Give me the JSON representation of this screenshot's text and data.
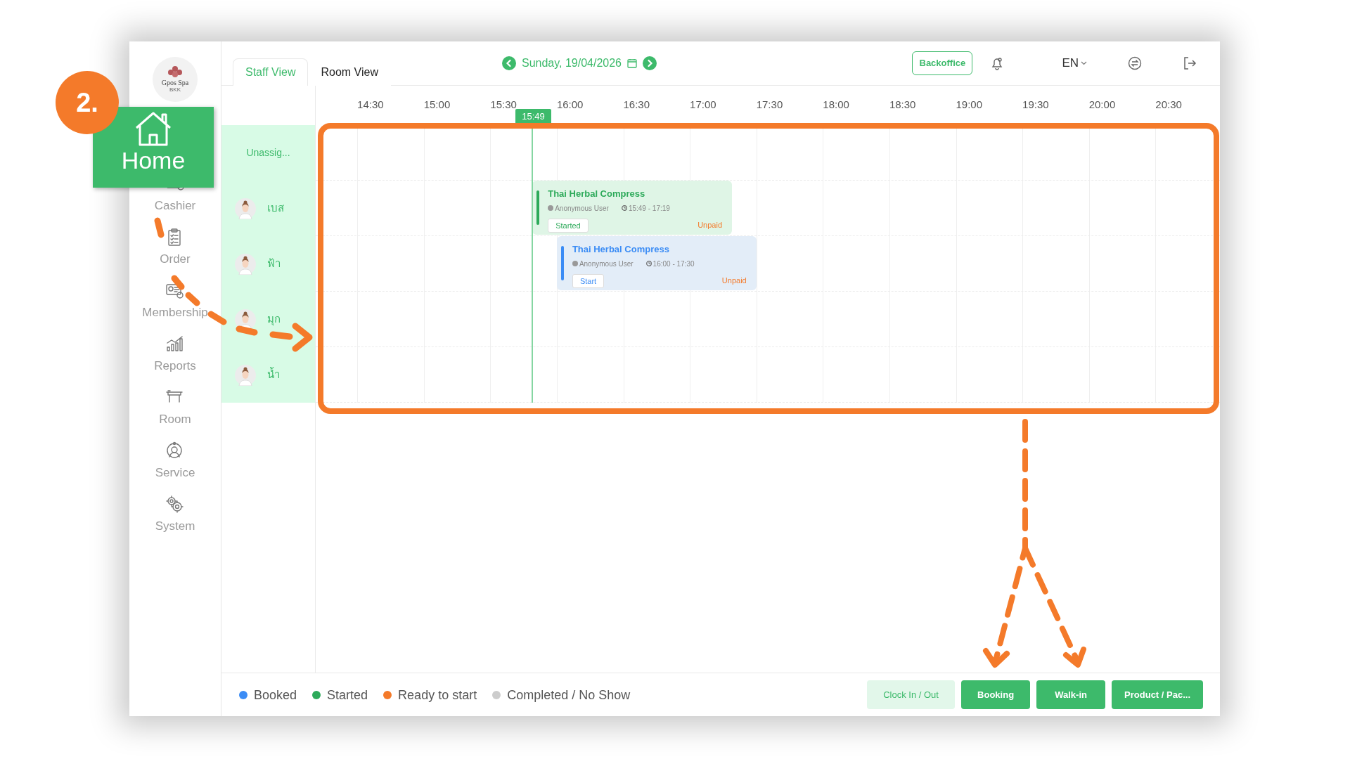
{
  "annotation": {
    "step": "2.",
    "callout": "Home"
  },
  "sidebar": {
    "logo_text": "Gpos Spa",
    "logo_subtext": "BKK",
    "items": [
      {
        "label": "Cashier"
      },
      {
        "label": "Order"
      },
      {
        "label": "Membership"
      },
      {
        "label": "Reports"
      },
      {
        "label": "Room"
      },
      {
        "label": "Service"
      },
      {
        "label": "System"
      }
    ]
  },
  "tabs": [
    {
      "label": "Staff View",
      "selected": true
    },
    {
      "label": "Room View",
      "selected": false
    }
  ],
  "date": "Sunday, 19/04/2026",
  "header": {
    "backoffice": "Backoffice",
    "language": "EN"
  },
  "timeline": {
    "times": [
      "14:30",
      "15:00",
      "15:30",
      "16:00",
      "16:30",
      "17:00",
      "17:30",
      "18:00",
      "18:30",
      "19:00",
      "19:30",
      "20:00",
      "20:30"
    ],
    "now": "15:49",
    "rows": [
      {
        "kind": "unassigned",
        "name": "Unassig..."
      },
      {
        "kind": "staff",
        "name": "เบส",
        "bookings": [
          {
            "kind": "started",
            "title": "Thai Herbal Compress",
            "customer": "Anonymous User",
            "time": "15:49 - 17:19",
            "action": "Started",
            "payment": "Unpaid"
          }
        ]
      },
      {
        "kind": "staff",
        "name": "ฟ้า",
        "bookings": [
          {
            "kind": "booked",
            "title": "Thai Herbal Compress",
            "customer": "Anonymous User",
            "time": "16:00 - 17:30",
            "action": "Start",
            "payment": "Unpaid"
          }
        ]
      },
      {
        "kind": "staff",
        "name": "มุก"
      },
      {
        "kind": "staff",
        "name": "น้ำ"
      }
    ]
  },
  "legend": [
    {
      "label": "Booked",
      "color": "#3b8cf5"
    },
    {
      "label": "Started",
      "color": "#2daa5a"
    },
    {
      "label": "Ready to start",
      "color": "#f47a2a"
    },
    {
      "label": "Completed / No Show",
      "color": "#cccccc"
    }
  ],
  "footer_buttons": [
    {
      "label": "Clock In / Out",
      "kind": "light"
    },
    {
      "label": "Booking",
      "kind": "solid"
    },
    {
      "label": "Walk-in",
      "kind": "solid"
    },
    {
      "label": "Product / Pac...",
      "kind": "solid"
    }
  ]
}
